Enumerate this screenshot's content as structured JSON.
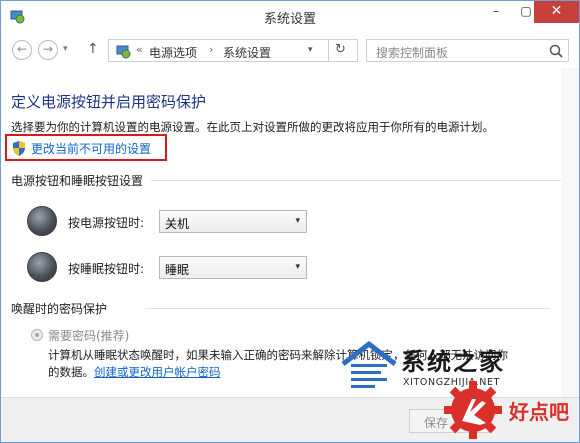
{
  "window": {
    "title": "系统设置",
    "controls": {
      "min": "–",
      "max": "▢",
      "close": "✕"
    }
  },
  "nav": {
    "back": "←",
    "forward": "→",
    "dropdown": "▾",
    "up": "↑",
    "separator": "«",
    "breadcrumb": [
      "电源选项",
      "系统设置"
    ],
    "arrow": "›",
    "address_dropdown": "▾",
    "refresh": "↻",
    "search_placeholder": "搜索控制面板"
  },
  "main": {
    "heading": "定义电源按钮并启用密码保护",
    "description": "选择要为你的计算机设置的电源设置。在此页上对设置所做的更改将应用于你所有的电源计划。",
    "change_link": "更改当前不可用的设置",
    "section_power": "电源按钮和睡眠按钮设置",
    "power_button_label": "按电源按钮时:",
    "power_button_value": "关机",
    "sleep_button_label": "按睡眠按钮时:",
    "sleep_button_value": "睡眠",
    "section_wake": "唤醒时的密码保护",
    "require_password": "需要密码(推荐)",
    "wake_text_1": "计算机从睡眠状态唤醒时，如果未输入正确的密码来解除计算机锁定，任何人都无法访问你",
    "wake_text_2": "的数据。",
    "account_link": "创建或更改用户帐户密码",
    "save_button": "保存"
  },
  "watermark": {
    "cn": "系统之家",
    "en": "XITONGZHIJIA.NET",
    "brand": "好点吧"
  },
  "colors": {
    "heading": "#1e3287",
    "link": "#1064c8",
    "highlight_border": "#d51a1a",
    "close_button": "#c7413a"
  }
}
